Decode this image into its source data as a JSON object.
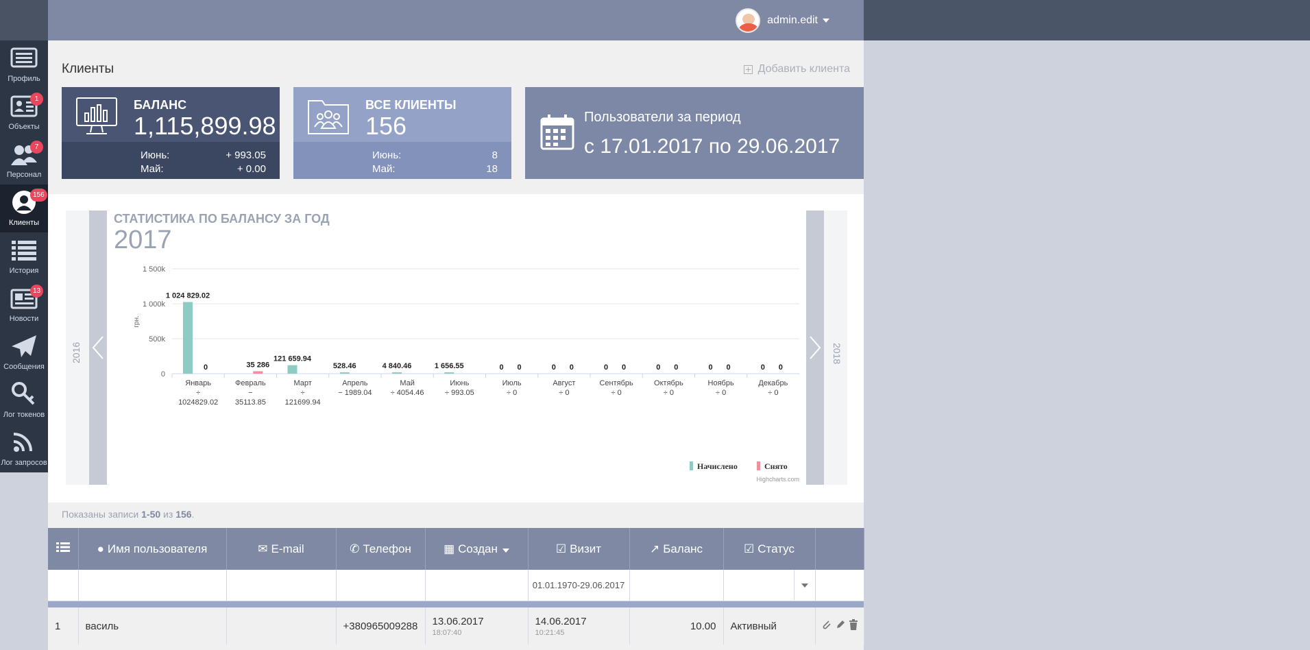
{
  "user": {
    "name": "admin.edit"
  },
  "sidebar": {
    "items": [
      {
        "label": "Профиль",
        "icon": "profile-list-icon",
        "badge": ""
      },
      {
        "label": "Объекты",
        "icon": "objects-card-icon",
        "badge": "1"
      },
      {
        "label": "Персонал",
        "icon": "staff-people-icon",
        "badge": "7"
      },
      {
        "label": "Клиенты",
        "icon": "clients-user-icon",
        "badge": "156"
      },
      {
        "label": "История",
        "icon": "history-list-icon",
        "badge": ""
      },
      {
        "label": "Новости",
        "icon": "news-icon",
        "badge": "13"
      },
      {
        "label": "Сообщения",
        "icon": "paper-plane-icon",
        "badge": ""
      },
      {
        "label": "Лог токенов",
        "icon": "key-icon",
        "badge": ""
      },
      {
        "label": "Лог запросов",
        "icon": "rss-icon",
        "badge": ""
      }
    ]
  },
  "page": {
    "title": "Клиенты",
    "add_client": "Добавить клиента"
  },
  "cards": {
    "balance": {
      "title": "БАЛАНС",
      "value": "1,115,899.98",
      "row1_label": "Июнь:",
      "row1_value": "+ 993.05",
      "row2_label": "Май:",
      "row2_value": "+ 0.00"
    },
    "clients": {
      "title": "ВСЕ КЛИЕНТЫ",
      "value": "156",
      "row1_label": "Июнь:",
      "row1_value": "8",
      "row2_label": "Май:",
      "row2_value": "18"
    },
    "period": {
      "title": "Пользователи за период",
      "range": "с 17.01.2017 по 29.06.2017"
    }
  },
  "year_nav": {
    "prev": "2016",
    "next": "2018"
  },
  "chart_data": {
    "type": "bar",
    "title": "СТАТИСТИКА ПО БАЛАНСУ ЗА ГОД",
    "subtitle": "2017",
    "ylabel": "грн.",
    "ylim": [
      0,
      1500000
    ],
    "yticks": [
      "0",
      "500k",
      "1 000k",
      "1 500k"
    ],
    "categories": [
      "Январь",
      "Февраль",
      "Март",
      "Апрель",
      "Май",
      "Июнь",
      "Июль",
      "Август",
      "Сентябрь",
      "Октябрь",
      "Ноябрь",
      "Декабрь"
    ],
    "category_sublabels": [
      "÷ 1024829.02",
      "− 35113.85",
      "÷ 121699.94",
      "− 1989.04",
      "÷ 4054.46",
      "÷ 993.05",
      "÷ 0",
      "÷ 0",
      "÷ 0",
      "÷ 0",
      "÷ 0",
      "÷ 0"
    ],
    "series": [
      {
        "name": "Начислено",
        "color": "#8ecbc3",
        "values": [
          1024829.02,
          0,
          121659.94,
          528.46,
          4840.46,
          1656.55,
          0,
          0,
          0,
          0,
          0,
          0
        ],
        "labels": [
          "1 024 829.02",
          "",
          "121 659.94",
          "528.46",
          "4 840.46",
          "1 656.55",
          "0",
          "0",
          "0",
          "0",
          "0",
          "0"
        ]
      },
      {
        "name": "Снято",
        "color": "#f0909d",
        "values": [
          0,
          35286,
          0,
          0,
          0,
          0,
          0,
          0,
          0,
          0,
          0,
          0
        ],
        "labels": [
          "0",
          "35 286",
          "",
          "",
          "",
          "",
          "0",
          "0",
          "0",
          "0",
          "0",
          "0"
        ]
      }
    ],
    "grid": true,
    "legend": "bottom-right",
    "credits": "Highcharts.com"
  },
  "table": {
    "shown_prefix": "Показаны записи ",
    "shown_range": "1-50",
    "shown_middle": " из ",
    "shown_total": "156",
    "shown_suffix": ".",
    "columns": [
      "Имя пользователя",
      "E-mail",
      "Телефон",
      "Создан",
      "Визит",
      "Баланс",
      "Статус"
    ],
    "filter_visit": "01.01.1970-29.06.2017",
    "rows": [
      {
        "num": "1",
        "name": "василь",
        "email": "",
        "phone": "+380965009288",
        "created_date": "13.06.2017",
        "created_time": "18:07:40",
        "visit_date": "14.06.2017",
        "visit_time": "10:21:45",
        "balance": "10.00",
        "status": "Активный"
      }
    ]
  }
}
